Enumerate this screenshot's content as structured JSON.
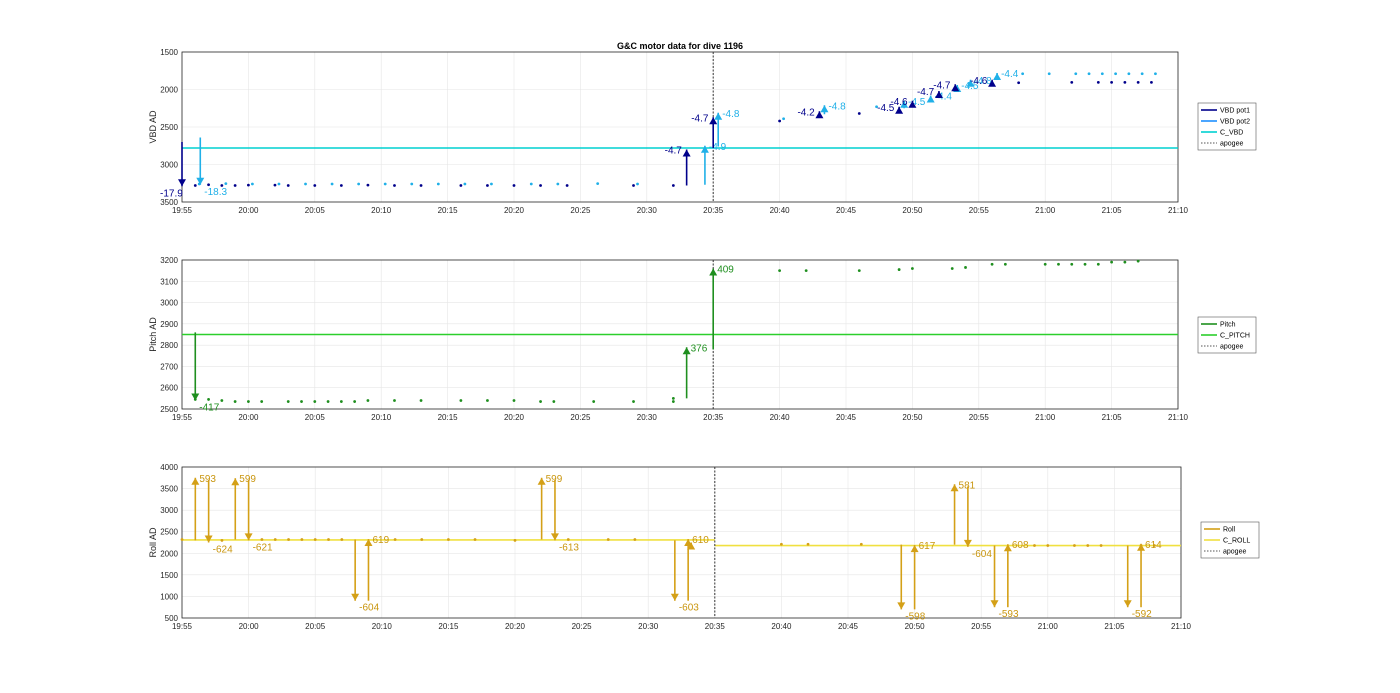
{
  "figure": {
    "title": "G&C motor data for dive 1196"
  },
  "chart_data": [
    {
      "type": "line",
      "title": "G&C motor data for dive 1196",
      "ylabel": "VBD AD",
      "xlim": [
        "19:55",
        "21:10"
      ],
      "ylim": [
        1500,
        3500
      ],
      "y_reversed": true,
      "yticks": [
        "1500",
        "2000",
        "2500",
        "3000",
        "3500"
      ],
      "xticks": [
        "19:55",
        "20:00",
        "20:05",
        "20:10",
        "20:15",
        "20:20",
        "20:25",
        "20:30",
        "20:35",
        "20:40",
        "20:45",
        "20:50",
        "20:55",
        "21:00",
        "21:05",
        "21:10"
      ],
      "grid": true,
      "legend": {
        "placement": "outside-right",
        "entries": [
          {
            "label": "VBD pot1",
            "color": "#00008b",
            "style": "solid"
          },
          {
            "label": "VBD pot2",
            "color": "#1e90ff",
            "style": "solid"
          },
          {
            "label": "C_VBD",
            "color": "#00d0d0",
            "style": "solid"
          },
          {
            "label": "apogee",
            "color": "#555555",
            "style": "dotted"
          }
        ]
      },
      "apogee": "20:35",
      "reference_line": {
        "name": "C_VBD",
        "y": 2780,
        "color": "#00d0d0"
      },
      "series": [
        {
          "name": "VBD pot1",
          "color": "#00008b",
          "points": [
            [
              "19:56",
              3280
            ],
            [
              "19:57",
              3270
            ],
            [
              "19:58",
              3280
            ],
            [
              "19:59",
              3280
            ],
            [
              "20:00",
              3275
            ],
            [
              "20:02",
              3275
            ],
            [
              "20:03",
              3280
            ],
            [
              "20:05",
              3280
            ],
            [
              "20:07",
              3280
            ],
            [
              "20:09",
              3275
            ],
            [
              "20:11",
              3280
            ],
            [
              "20:13",
              3280
            ],
            [
              "20:16",
              3280
            ],
            [
              "20:18",
              3280
            ],
            [
              "20:20",
              3280
            ],
            [
              "20:22",
              3280
            ],
            [
              "20:24",
              3280
            ],
            [
              "20:29",
              3280
            ],
            [
              "20:32",
              3280
            ],
            [
              "20:40",
              2420
            ],
            [
              "20:46",
              2320
            ],
            [
              "20:56",
              1910
            ],
            [
              "20:58",
              1910
            ],
            [
              "21:02",
              1905
            ],
            [
              "21:04",
              1905
            ],
            [
              "21:05",
              1905
            ],
            [
              "21:06",
              1905
            ],
            [
              "21:07",
              1905
            ],
            [
              "21:08",
              1905
            ]
          ]
        },
        {
          "name": "VBD pot2",
          "color": "#20b0e8",
          "points": [
            [
              "19:56",
              3260
            ],
            [
              "19:58",
              3255
            ],
            [
              "20:00",
              3260
            ],
            [
              "20:02",
              3260
            ],
            [
              "20:04",
              3260
            ],
            [
              "20:06",
              3260
            ],
            [
              "20:08",
              3260
            ],
            [
              "20:10",
              3260
            ],
            [
              "20:12",
              3260
            ],
            [
              "20:14",
              3260
            ],
            [
              "20:16",
              3260
            ],
            [
              "20:18",
              3260
            ],
            [
              "20:21",
              3260
            ],
            [
              "20:23",
              3260
            ],
            [
              "20:26",
              3255
            ],
            [
              "20:29",
              3260
            ],
            [
              "20:40",
              2390
            ],
            [
              "20:47",
              2230
            ],
            [
              "20:58",
              1790
            ],
            [
              "21:00",
              1790
            ],
            [
              "21:02",
              1790
            ],
            [
              "21:03",
              1790
            ],
            [
              "21:04",
              1790
            ],
            [
              "21:05",
              1790
            ],
            [
              "21:06",
              1790
            ],
            [
              "21:07",
              1790
            ],
            [
              "21:08",
              1790
            ]
          ]
        }
      ],
      "moves": [
        {
          "series": "VBD pot1",
          "x": "19:55",
          "from": 2700,
          "to": 3290,
          "label": "-17.9"
        },
        {
          "series": "VBD pot2",
          "x": "19:56",
          "from": 2640,
          "to": 3270,
          "label": "-18.3"
        },
        {
          "series": "VBD pot1",
          "x": "20:33",
          "from": 3280,
          "to": 2800,
          "label": "-4.7"
        },
        {
          "series": "VBD pot2",
          "x": "20:34",
          "from": 3270,
          "to": 2750,
          "label": "-4.9"
        },
        {
          "series": "VBD pot1",
          "x": "20:35",
          "from": 2780,
          "to": 2370,
          "label": "-4.7"
        },
        {
          "series": "VBD pot2",
          "x": "20:35",
          "from": 2760,
          "to": 2310,
          "label": "-4.8"
        },
        {
          "series": "VBD pot1",
          "x": "20:43",
          "from": 2380,
          "to": 2290,
          "label": "-4.2"
        },
        {
          "series": "VBD pot2",
          "x": "20:43",
          "from": 2330,
          "to": 2210,
          "label": "-4.8"
        },
        {
          "series": "VBD pot1",
          "x": "20:49",
          "from": 2310,
          "to": 2230,
          "label": "-4.5"
        },
        {
          "series": "VBD pot2",
          "x": "20:49",
          "from": 2250,
          "to": 2150,
          "label": "-4.5"
        },
        {
          "series": "VBD pot1",
          "x": "20:50",
          "from": 2240,
          "to": 2150,
          "label": "-4.6"
        },
        {
          "series": "VBD pot2",
          "x": "20:51",
          "from": 2170,
          "to": 2080,
          "label": "-4.4"
        },
        {
          "series": "VBD pot1",
          "x": "20:52",
          "from": 2110,
          "to": 2020,
          "label": "-4.7"
        },
        {
          "series": "VBD pot2",
          "x": "20:53",
          "from": 2030,
          "to": 1940,
          "label": "-4.5"
        },
        {
          "series": "VBD pot1",
          "x": "20:53",
          "from": 2010,
          "to": 1930,
          "label": "-4.7"
        },
        {
          "series": "VBD pot2",
          "x": "20:54",
          "from": 1960,
          "to": 1870,
          "label": "-4.8"
        },
        {
          "series": "VBD pot1",
          "x": "20:56",
          "from": 1950,
          "to": 1870,
          "label": "-4.6"
        },
        {
          "series": "VBD pot2",
          "x": "20:56",
          "from": 1860,
          "to": 1780,
          "label": "-4.4"
        }
      ]
    },
    {
      "type": "line",
      "ylabel": "Pitch AD",
      "xlim": [
        "19:55",
        "21:10"
      ],
      "ylim": [
        2500,
        3200
      ],
      "yticks": [
        "2500",
        "2600",
        "2700",
        "2800",
        "2900",
        "3000",
        "3100",
        "3200"
      ],
      "xticks": [
        "19:55",
        "20:00",
        "20:05",
        "20:10",
        "20:15",
        "20:20",
        "20:25",
        "20:30",
        "20:35",
        "20:40",
        "20:45",
        "20:50",
        "20:55",
        "21:00",
        "21:05",
        "21:10"
      ],
      "grid": true,
      "legend": {
        "placement": "outside-right",
        "entries": [
          {
            "label": "Pitch",
            "color": "#1f8f1f",
            "style": "solid"
          },
          {
            "label": "C_PITCH",
            "color": "#2ccf2c",
            "style": "solid"
          },
          {
            "label": "apogee",
            "color": "#555555",
            "style": "dotted"
          }
        ]
      },
      "apogee": "20:35",
      "reference_line": {
        "name": "C_PITCH",
        "y": 2850,
        "color": "#2ccf2c"
      },
      "series": [
        {
          "name": "Pitch",
          "color": "#1f8f1f",
          "points": [
            [
              "19:56",
              2545
            ],
            [
              "19:57",
              2545
            ],
            [
              "19:58",
              2540
            ],
            [
              "19:59",
              2535
            ],
            [
              "20:00",
              2535
            ],
            [
              "20:01",
              2535
            ],
            [
              "20:03",
              2535
            ],
            [
              "20:04",
              2535
            ],
            [
              "20:05",
              2535
            ],
            [
              "20:06",
              2535
            ],
            [
              "20:07",
              2535
            ],
            [
              "20:08",
              2535
            ],
            [
              "20:09",
              2540
            ],
            [
              "20:11",
              2540
            ],
            [
              "20:13",
              2540
            ],
            [
              "20:16",
              2540
            ],
            [
              "20:18",
              2540
            ],
            [
              "20:20",
              2540
            ],
            [
              "20:22",
              2535
            ],
            [
              "20:23",
              2535
            ],
            [
              "20:26",
              2535
            ],
            [
              "20:29",
              2535
            ],
            [
              "20:32",
              2535
            ],
            [
              "20:32",
              2550
            ],
            [
              "20:40",
              3150
            ],
            [
              "20:42",
              3150
            ],
            [
              "20:46",
              3150
            ],
            [
              "20:49",
              3155
            ],
            [
              "20:50",
              3160
            ],
            [
              "20:53",
              3160
            ],
            [
              "20:54",
              3165
            ],
            [
              "20:56",
              3180
            ],
            [
              "20:57",
              3180
            ],
            [
              "21:00",
              3180
            ],
            [
              "21:01",
              3180
            ],
            [
              "21:02",
              3180
            ],
            [
              "21:03",
              3180
            ],
            [
              "21:04",
              3180
            ],
            [
              "21:05",
              3190
            ],
            [
              "21:06",
              3190
            ],
            [
              "21:07",
              3195
            ]
          ]
        }
      ],
      "moves": [
        {
          "series": "Pitch",
          "x": "19:56",
          "from": 2860,
          "to": 2540,
          "label": "-417"
        },
        {
          "series": "Pitch",
          "x": "20:33",
          "from": 2550,
          "to": 2790,
          "label": "376"
        },
        {
          "series": "Pitch",
          "x": "20:35",
          "from": 2780,
          "to": 3160,
          "label": "409"
        }
      ]
    },
    {
      "type": "line",
      "ylabel": "Roll AD",
      "xlim": [
        "19:55",
        "21:10"
      ],
      "ylim": [
        500,
        4000
      ],
      "yticks": [
        "500",
        "1000",
        "1500",
        "2000",
        "2500",
        "3000",
        "3500",
        "4000"
      ],
      "xticks": [
        "19:55",
        "20:00",
        "20:05",
        "20:10",
        "20:15",
        "20:20",
        "20:25",
        "20:30",
        "20:35",
        "20:40",
        "20:45",
        "20:50",
        "20:55",
        "21:00",
        "21:05",
        "21:10"
      ],
      "grid": true,
      "legend": {
        "placement": "outside-right",
        "entries": [
          {
            "label": "Roll",
            "color": "#d4a017",
            "style": "solid"
          },
          {
            "label": "C_ROLL",
            "color": "#f0e040",
            "style": "solid"
          },
          {
            "label": "apogee",
            "color": "#555555",
            "style": "dotted"
          }
        ]
      },
      "apogee": "20:35",
      "reference_lines": [
        {
          "name": "C_ROLL",
          "x_from": "19:55",
          "x_to": "20:35",
          "y": 2310,
          "color": "#f0e040"
        },
        {
          "name": "C_ROLL",
          "x_from": "20:35",
          "x_to": "21:10",
          "y": 2180,
          "color": "#f0e040"
        }
      ],
      "series": [
        {
          "name": "Roll",
          "color": "#d4a017",
          "points": [
            [
              "19:55",
              2320
            ],
            [
              "19:57",
              2310
            ],
            [
              "19:58",
              2300
            ],
            [
              "20:01",
              2320
            ],
            [
              "20:02",
              2320
            ],
            [
              "20:03",
              2320
            ],
            [
              "20:04",
              2320
            ],
            [
              "20:05",
              2320
            ],
            [
              "20:06",
              2320
            ],
            [
              "20:07",
              2320
            ],
            [
              "20:11",
              2320
            ],
            [
              "20:13",
              2320
            ],
            [
              "20:15",
              2320
            ],
            [
              "20:17",
              2320
            ],
            [
              "20:20",
              2300
            ],
            [
              "20:24",
              2320
            ],
            [
              "20:27",
              2320
            ],
            [
              "20:29",
              2320
            ],
            [
              "20:40",
              2210
            ],
            [
              "20:42",
              2210
            ],
            [
              "20:46",
              2210
            ],
            [
              "20:59",
              2180
            ],
            [
              "21:00",
              2180
            ],
            [
              "21:02",
              2180
            ],
            [
              "21:03",
              2180
            ],
            [
              "21:04",
              2180
            ],
            [
              "21:07",
              2180
            ],
            [
              "21:08",
              2180
            ]
          ]
        }
      ],
      "moves": [
        {
          "series": "Roll",
          "x": "19:56",
          "from": 2300,
          "to": 3750,
          "label": "593"
        },
        {
          "series": "Roll",
          "x": "19:57",
          "from": 3700,
          "to": 2250,
          "label": "-624"
        },
        {
          "series": "Roll",
          "x": "19:59",
          "from": 2320,
          "to": 3740,
          "label": "599"
        },
        {
          "series": "Roll",
          "x": "20:00",
          "from": 3700,
          "to": 2300,
          "label": "-621"
        },
        {
          "series": "Roll",
          "x": "20:08",
          "from": 2320,
          "to": 900,
          "label": "-604"
        },
        {
          "series": "Roll",
          "x": "20:09",
          "from": 900,
          "to": 2330,
          "label": "619"
        },
        {
          "series": "Roll",
          "x": "20:22",
          "from": 2320,
          "to": 3750,
          "label": "599"
        },
        {
          "series": "Roll",
          "x": "20:23",
          "from": 3700,
          "to": 2300,
          "label": "-613"
        },
        {
          "series": "Roll",
          "x": "20:32",
          "from": 2300,
          "to": 900,
          "label": "-603"
        },
        {
          "series": "Roll",
          "x": "20:33",
          "from": 900,
          "to": 2330,
          "label": "610"
        },
        {
          "series": "Roll",
          "x": "20:33",
          "from": 2150,
          "to": 2250,
          "label": ""
        },
        {
          "series": "Roll",
          "x": "20:49",
          "from": 2200,
          "to": 700,
          "label": "-598"
        },
        {
          "series": "Roll",
          "x": "20:50",
          "from": 700,
          "to": 2190,
          "label": "617"
        },
        {
          "series": "Roll",
          "x": "20:53",
          "from": 2200,
          "to": 3600,
          "label": "581"
        },
        {
          "series": "Roll",
          "x": "20:54",
          "from": 3550,
          "to": 2150,
          "label": "-604"
        },
        {
          "series": "Roll",
          "x": "20:56",
          "from": 2180,
          "to": 750,
          "label": "-593"
        },
        {
          "series": "Roll",
          "x": "20:57",
          "from": 750,
          "to": 2210,
          "label": "608"
        },
        {
          "series": "Roll",
          "x": "21:06",
          "from": 2180,
          "to": 750,
          "label": "-592"
        },
        {
          "series": "Roll",
          "x": "21:07",
          "from": 750,
          "to": 2220,
          "label": "614"
        }
      ]
    }
  ]
}
